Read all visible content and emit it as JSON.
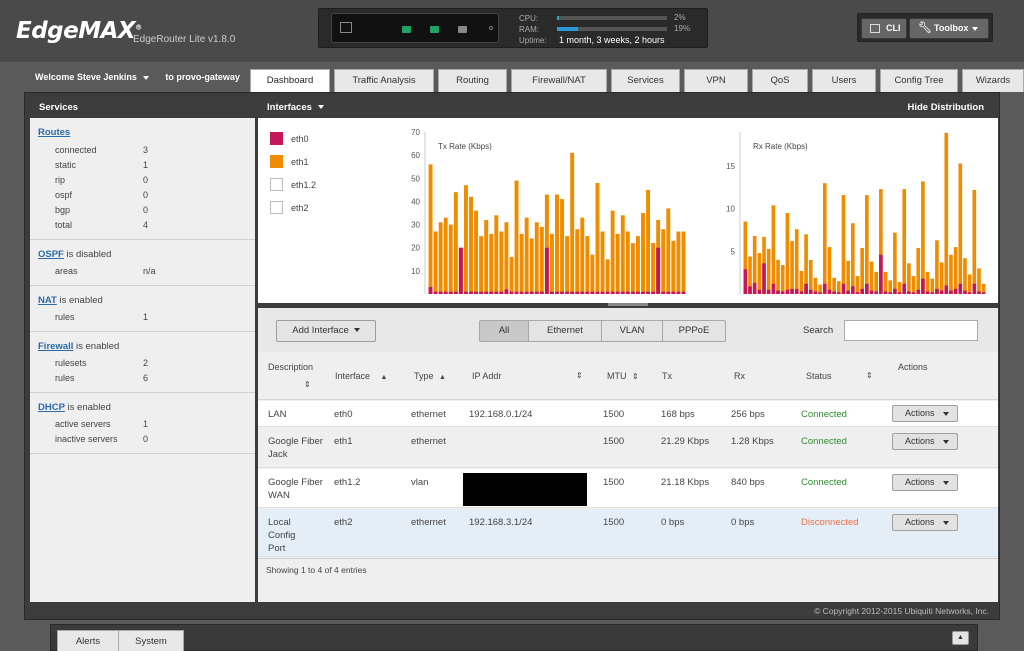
{
  "brand": {
    "logo": "EdgeMAX",
    "trademark": "®",
    "model": "EdgeRouter Lite v1.8.0"
  },
  "status": {
    "cpu_label": "CPU:",
    "cpu_value": "2%",
    "cpu_fraction": 0.02,
    "ram_label": "RAM:",
    "ram_value": "19%",
    "ram_fraction": 0.19,
    "uptime_label": "Uptime:",
    "uptime_value": "1 month, 3 weeks, 2 hours"
  },
  "toolbar": {
    "cli_label": "CLI",
    "toolbox_label": "Toolbox"
  },
  "user": {
    "welcome": "Welcome Steve Jenkins",
    "to_host": "to provo-gateway"
  },
  "tabs": [
    {
      "label": "Dashboard",
      "active": true
    },
    {
      "label": "Traffic Analysis"
    },
    {
      "label": "Routing"
    },
    {
      "label": "Firewall/NAT"
    },
    {
      "label": "Services"
    },
    {
      "label": "VPN"
    },
    {
      "label": "QoS"
    },
    {
      "label": "Users"
    },
    {
      "label": "Config Tree"
    },
    {
      "label": "Wizards"
    }
  ],
  "sidebar": {
    "title": "Services",
    "routes": {
      "title": "Routes",
      "rows": [
        {
          "k": "connected",
          "v": "3"
        },
        {
          "k": "static",
          "v": "1"
        },
        {
          "k": "rip",
          "v": "0"
        },
        {
          "k": "ospf",
          "v": "0"
        },
        {
          "k": "bgp",
          "v": "0"
        },
        {
          "k": "total",
          "v": "4"
        }
      ]
    },
    "ospf": {
      "title": "OSPF",
      "status": " is disabled",
      "rows": [
        {
          "k": "areas",
          "v": "n/a"
        }
      ]
    },
    "nat": {
      "title": "NAT",
      "status": " is enabled",
      "rows": [
        {
          "k": "rules",
          "v": "1"
        }
      ]
    },
    "firewall": {
      "title": "Firewall",
      "status": " is enabled",
      "rows": [
        {
          "k": "rulesets",
          "v": "2"
        },
        {
          "k": "rules",
          "v": "6"
        }
      ]
    },
    "dhcp": {
      "title": "DHCP",
      "status": " is enabled",
      "rows": [
        {
          "k": "active servers",
          "v": "1"
        },
        {
          "k": "inactive servers",
          "v": "0"
        }
      ]
    }
  },
  "interfaces_panel": {
    "title": "Interfaces",
    "hide_distribution": "Hide Distribution"
  },
  "legend": [
    {
      "name": "eth0",
      "color": "#c2185b"
    },
    {
      "name": "eth1",
      "color": "#f08c00"
    },
    {
      "name": "eth1.2",
      "color": "#ffffff"
    },
    {
      "name": "eth2",
      "color": "#ffffff"
    }
  ],
  "chart_data": [
    {
      "type": "bar",
      "title": "Tx Rate (Kbps)",
      "ylim": [
        0,
        70
      ],
      "yticks": [
        10,
        20,
        30,
        40,
        50,
        60,
        70
      ],
      "series": [
        {
          "name": "eth1",
          "color": "#f08c00",
          "values": [
            56,
            27,
            31,
            33,
            30,
            44,
            20,
            47,
            42,
            36,
            25,
            32,
            26,
            34,
            27,
            31,
            16,
            49,
            26,
            33,
            24,
            31,
            29,
            43,
            26,
            43,
            41,
            25,
            61,
            28,
            33,
            25,
            17,
            48,
            27,
            15,
            36,
            26,
            34,
            27,
            22,
            25,
            35,
            45,
            22,
            32,
            28,
            37,
            23,
            27,
            27
          ]
        },
        {
          "name": "eth0",
          "color": "#c2185b",
          "values": [
            3,
            1,
            1,
            1,
            1,
            1,
            20,
            1,
            1,
            1,
            1,
            1,
            1,
            1,
            1,
            2,
            1,
            1,
            1,
            1,
            1,
            1,
            1,
            20,
            1,
            1,
            1,
            1,
            1,
            1,
            1,
            1,
            1,
            1,
            1,
            1,
            1,
            1,
            1,
            1,
            1,
            1,
            1,
            1,
            1,
            20,
            1,
            1,
            1,
            1,
            1
          ]
        }
      ]
    },
    {
      "type": "bar",
      "title": "Rx Rate (Kbps)",
      "ylim": [
        0,
        19
      ],
      "yticks": [
        5,
        10,
        15
      ],
      "series": [
        {
          "name": "eth1",
          "color": "#f08c00",
          "values": [
            8.5,
            4.4,
            6.8,
            4.8,
            6.7,
            5.3,
            10.4,
            4,
            3.4,
            9.5,
            6.2,
            7.6,
            2.7,
            7,
            4,
            1.9,
            1.1,
            13,
            5.5,
            1.9,
            1.5,
            11.6,
            3.9,
            8.3,
            2.1,
            5.4,
            11.6,
            3.8,
            2.6,
            12.3,
            2.6,
            1.6,
            7.2,
            1.4,
            12.3,
            3.6,
            2.1,
            5.4,
            13.2,
            2.6,
            1.8,
            6.3,
            3.7,
            18.9,
            4.6,
            5.5,
            15.3,
            4.2,
            2.3,
            12.2,
            3,
            1.2
          ]
        },
        {
          "name": "eth0",
          "color": "#c2185b",
          "values": [
            2.9,
            0.9,
            1.3,
            0.5,
            3.6,
            0.5,
            1.2,
            0.4,
            0.3,
            0.5,
            0.6,
            0.6,
            0.3,
            1.2,
            0.5,
            0.3,
            0.2,
            1.2,
            0.5,
            0.3,
            0.2,
            1.2,
            0.4,
            0.9,
            0.2,
            0.6,
            1.2,
            0.4,
            0.3,
            4.6,
            0.3,
            0.2,
            0.6,
            0.2,
            1.2,
            0.3,
            0.2,
            0.5,
            1.8,
            0.3,
            0.2,
            0.6,
            0.4,
            1,
            0.4,
            0.6,
            1.2,
            0.4,
            0.2,
            1.2,
            0.3,
            0.2
          ]
        }
      ]
    }
  ],
  "table_toolbar": {
    "add_interface": "Add Interface",
    "filters": [
      "All",
      "Ethernet",
      "VLAN",
      "PPPoE"
    ],
    "search_label": "Search",
    "search_value": ""
  },
  "columns": [
    "Description",
    "Interface",
    "Type",
    "IP Addr",
    "MTU",
    "Tx",
    "Rx",
    "Status",
    "Actions"
  ],
  "rows": [
    {
      "description": "LAN",
      "interface": "eth0",
      "type": "ethernet",
      "ip": "192.168.0.1/24",
      "mtu": "1500",
      "tx": "168 bps",
      "rx": "256 bps",
      "status": "Connected",
      "status_color": "#2e8b2e",
      "action": "Actions"
    },
    {
      "description": "Google Fiber Jack",
      "interface": "eth1",
      "type": "ethernet",
      "ip": "",
      "mtu": "1500",
      "tx": "21.29 Kbps",
      "rx": "1.28 Kbps",
      "status": "Connected",
      "status_color": "#2e8b2e",
      "action": "Actions"
    },
    {
      "description": "Google Fiber WAN",
      "interface": "eth1.2",
      "type": "vlan",
      "ip": "",
      "mtu": "1500",
      "tx": "21.18 Kbps",
      "rx": "840 bps",
      "status": "Connected",
      "status_color": "#2e8b2e",
      "action": "Actions"
    },
    {
      "description": "Local Config Port",
      "interface": "eth2",
      "type": "ethernet",
      "ip": "192.168.3.1/24",
      "mtu": "1500",
      "tx": "0 bps",
      "rx": "0 bps",
      "status": "Disconnected",
      "status_color": "#e8734a",
      "action": "Actions"
    }
  ],
  "table_footer": "Showing 1 to 4 of 4 entries",
  "copyright": "© Copyright 2012-2015 Ubiquiti Networks, Inc.",
  "bottom_tabs": [
    "Alerts",
    "System"
  ]
}
